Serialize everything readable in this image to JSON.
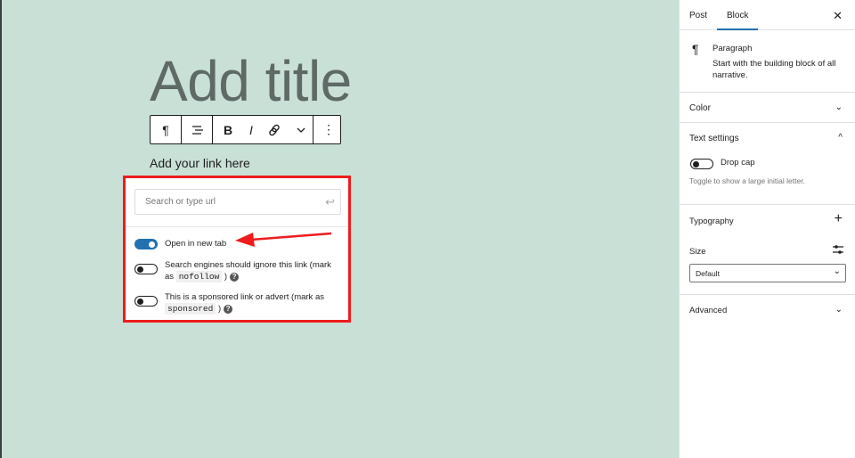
{
  "editor": {
    "title_placeholder": "Add title",
    "paragraph": "Add your link here",
    "toolbar": {
      "paragraph": "¶",
      "align": "☰",
      "bold": "B",
      "italic": "I",
      "link": "🔗",
      "more": "⌄",
      "options": "⋮"
    }
  },
  "link_popover": {
    "search_placeholder": "Search or type url",
    "options": [
      {
        "label": "Open in new tab",
        "on": true
      },
      {
        "label_pre": "Search engines should ignore this link (mark as ",
        "code": "nofollow",
        "label_post": " )",
        "on": false
      },
      {
        "label_pre": "This is a sponsored link or advert (mark as ",
        "code": "sponsored",
        "label_post": " )",
        "on": false
      }
    ]
  },
  "sidebar": {
    "tabs": [
      "Post",
      "Block"
    ],
    "active_tab": "Block",
    "close": "✕",
    "block": {
      "icon": "¶",
      "name": "Paragraph",
      "description": "Start with the building block of all narrative."
    },
    "color": "Color",
    "text_settings": {
      "title": "Text settings",
      "drop_cap": "Drop cap",
      "drop_cap_help": "Toggle to show a large initial letter."
    },
    "typography": {
      "title": "Typography",
      "size_label": "Size",
      "size_value": "Default"
    },
    "advanced": "Advanced"
  },
  "colors": {
    "accent": "#2271b1",
    "highlight": "#ee1c1c",
    "canvas": "#c9e0d7"
  }
}
